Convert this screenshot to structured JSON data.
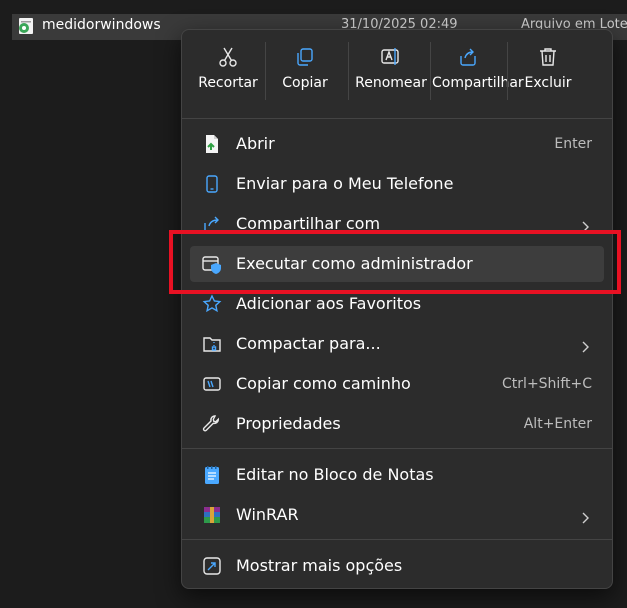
{
  "file": {
    "name": "medidorwindows",
    "date": "31/10/2025 02:49",
    "type": "Arquivo em Lote",
    "icon": "batch-file-gear-icon"
  },
  "toolbar": [
    {
      "label": "Recortar",
      "icon": "scissors-icon"
    },
    {
      "label": "Copiar",
      "icon": "copy-icon"
    },
    {
      "label": "Renomear",
      "icon": "rename-icon"
    },
    {
      "label": "Compartilhar",
      "icon": "share-icon"
    },
    {
      "label": "Excluir",
      "icon": "trash-icon"
    }
  ],
  "items": [
    {
      "label": "Abrir",
      "shortcut": "Enter",
      "icon": "open-file-icon"
    },
    {
      "label": "Enviar para o Meu Telefone",
      "icon": "phone-icon"
    },
    {
      "label": "Compartilhar com",
      "icon": "share-with-icon",
      "submenu": true
    },
    {
      "label": "Executar como administrador",
      "icon": "shield-admin-icon",
      "highlighted": true
    },
    {
      "label": "Adicionar aos Favoritos",
      "icon": "star-icon"
    },
    {
      "label": "Compactar para...",
      "icon": "compress-folder-icon",
      "submenu": true
    },
    {
      "label": "Copiar como caminho",
      "shortcut": "Ctrl+Shift+C",
      "icon": "copy-path-icon"
    },
    {
      "label": "Propriedades",
      "shortcut": "Alt+Enter",
      "icon": "wrench-icon"
    },
    {
      "label": "Editar no Bloco de Notas",
      "icon": "notepad-icon"
    },
    {
      "label": "WinRAR",
      "icon": "winrar-icon",
      "submenu": true
    },
    {
      "label": "Mostrar mais opções",
      "icon": "more-options-icon"
    }
  ],
  "colors": {
    "menu_bg": "#2c2c2c",
    "hover_bg": "#3d3d3d",
    "accent_blue": "#4aa8ff",
    "annotation_red": "#e81123"
  }
}
